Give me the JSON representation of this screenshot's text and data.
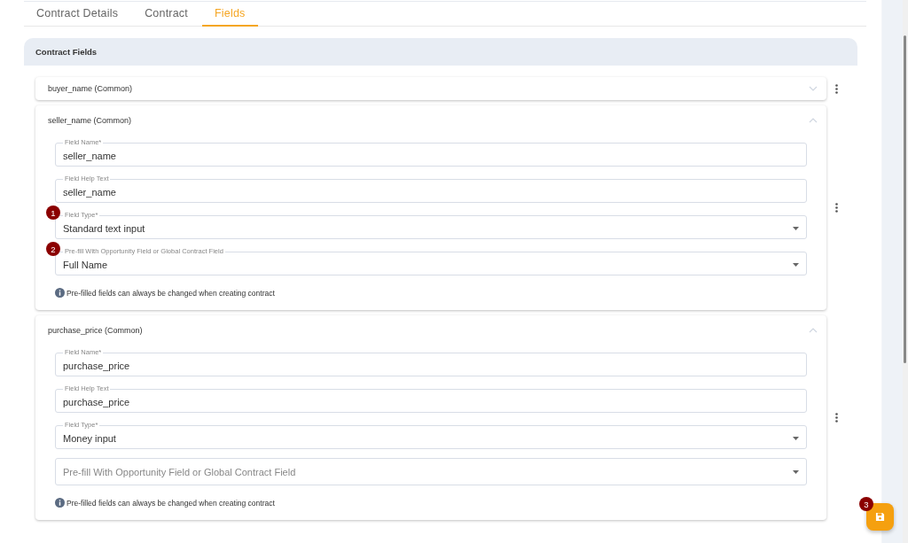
{
  "tabs": [
    {
      "label": "Contract Details",
      "selected": false
    },
    {
      "label": "Contract",
      "selected": false
    },
    {
      "label": "Fields",
      "selected": true
    }
  ],
  "card": {
    "title": "Contract Fields",
    "items": [
      {
        "title": "buyer_name (Common)",
        "expanded": false
      },
      {
        "title": "seller_name (Common)",
        "expanded": true,
        "fields": [
          {
            "kind": "text",
            "label": "Field Name*",
            "value": "seller_name"
          },
          {
            "kind": "text",
            "label": "Field Help Text",
            "value": "seller_name"
          },
          {
            "kind": "select",
            "label": "Field Type*",
            "value": "Standard text input",
            "marker": "1"
          },
          {
            "kind": "select",
            "label": "Pre-fill With Opportunity Field or Global Contract Field",
            "value": "Full Name",
            "marker": "2"
          }
        ],
        "note": "Pre-filled fields can always be changed when creating contract"
      },
      {
        "title": "purchase_price (Common)",
        "expanded": true,
        "fields": [
          {
            "kind": "text",
            "label": "Field Name*",
            "value": "purchase_price"
          },
          {
            "kind": "text",
            "label": "Field Help Text",
            "value": "purchase_price"
          },
          {
            "kind": "select",
            "label": "Field Type*",
            "value": "Money input"
          },
          {
            "kind": "select",
            "placeholder": "Pre-fill With Opportunity Field or Global Contract Field"
          }
        ],
        "note": "Pre-filled fields can always be changed when creating contract"
      }
    ]
  },
  "save_button": {
    "marker": "3"
  }
}
